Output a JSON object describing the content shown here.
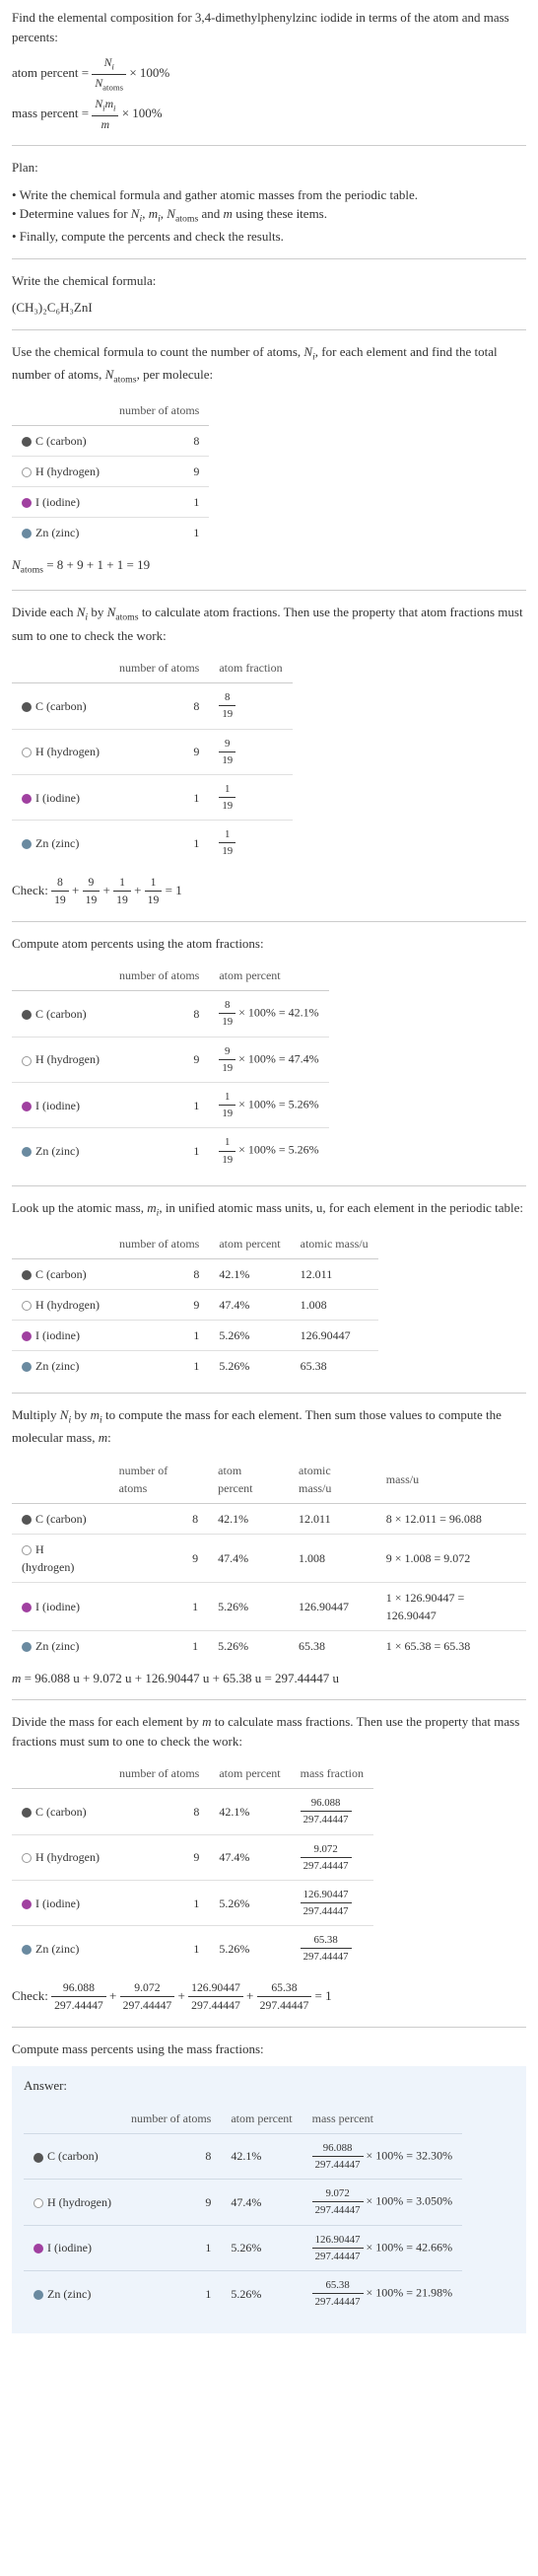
{
  "title": "Find the elemental composition for 3,4-dimethylphenylzinc iodide in terms of the atom and mass percents:",
  "atom_percent_formula": "atom percent = ",
  "atom_percent_frac_num": "N_i",
  "atom_percent_frac_den": "N_atoms",
  "times_100": " × 100%",
  "mass_percent_formula": "mass percent = ",
  "mass_percent_frac_num": "N_i m_i",
  "mass_percent_frac_den": "m",
  "plan_title": "Plan:",
  "plan_1": "• Write the chemical formula and gather atomic masses from the periodic table.",
  "plan_2": "• Determine values for N_i, m_i, N_atoms and m using these items.",
  "plan_3": "• Finally, compute the percents and check the results.",
  "write_formula_title": "Write the chemical formula:",
  "chem_formula": "(CH₃)₂C₆H₃ZnI",
  "count_atoms_text": "Use the chemical formula to count the number of atoms, N_i, for each element and find the total number of atoms, N_atoms, per molecule:",
  "headers": {
    "element": "",
    "num_atoms": "number of atoms",
    "atom_fraction": "atom fraction",
    "atom_percent": "atom percent",
    "atomic_mass": "atomic mass/u",
    "mass": "mass/u",
    "mass_fraction": "mass fraction",
    "mass_percent": "mass percent"
  },
  "elements": [
    {
      "symbol": "C",
      "name": "(carbon)",
      "dot": "dot-c",
      "n": "8",
      "frac_num": "8",
      "frac_den": "19",
      "pct": "42.1%",
      "pct_calc_num": "8",
      "mass": "12.011",
      "mass_calc": "8 × 12.011 = 96.088",
      "mass_val": "96.088",
      "mass_frac_num": "96.088",
      "final_pct": "32.30%",
      "final_mass_pct_calc_num": "96.088"
    },
    {
      "symbol": "H",
      "name": "(hydrogen)",
      "dot": "dot-h",
      "n": "9",
      "frac_num": "9",
      "frac_den": "19",
      "pct": "47.4%",
      "pct_calc_num": "9",
      "mass": "1.008",
      "mass_calc": "9 × 1.008 = 9.072",
      "mass_val": "9.072",
      "mass_frac_num": "9.072",
      "final_pct": "3.050%",
      "final_mass_pct_calc_num": "9.072"
    },
    {
      "symbol": "I",
      "name": "(iodine)",
      "dot": "dot-i",
      "n": "1",
      "frac_num": "1",
      "frac_den": "19",
      "pct": "5.26%",
      "pct_calc_num": "1",
      "mass": "126.90447",
      "mass_calc": "1 × 126.90447 = 126.90447",
      "mass_val": "126.90447",
      "mass_frac_num": "126.90447",
      "final_pct": "42.66%",
      "final_mass_pct_calc_num": "126.90447"
    },
    {
      "symbol": "Zn",
      "name": "(zinc)",
      "dot": "dot-zn",
      "n": "1",
      "frac_num": "1",
      "frac_den": "19",
      "pct": "5.26%",
      "pct_calc_num": "1",
      "mass": "65.38",
      "mass_calc": "1 × 65.38 = 65.38",
      "mass_val": "65.38",
      "mass_frac_num": "65.38",
      "final_pct": "21.98%",
      "final_mass_pct_calc_num": "65.38"
    }
  ],
  "n_atoms_calc": "N_atoms = 8 + 9 + 1 + 1 = 19",
  "divide_text": "Divide each N_i by N_atoms to calculate atom fractions. Then use the property that atom fractions must sum to one to check the work:",
  "check_frac_text": "Check: ",
  "check_frac_eq_1": " = 1",
  "compute_atom_pct": "Compute atom percents using the atom fractions:",
  "lookup_mass": "Look up the atomic mass, m_i, in unified atomic mass units, u, for each element in the periodic table:",
  "multiply_text": "Multiply N_i by m_i to compute the mass for each element. Then sum those values to compute the molecular mass, m:",
  "m_calc": "m = 96.088 u + 9.072 u + 126.90447 u + 65.38 u = 297.44447 u",
  "divide_mass_text": "Divide the mass for each element by m to calculate mass fractions. Then use the property that mass fractions must sum to one to check the work:",
  "mass_den": "297.44447",
  "compute_mass_pct": "Compute mass percents using the mass fractions:",
  "answer_label": "Answer:",
  "chart_data": {
    "type": "table",
    "title": "Elemental composition of 3,4-dimethylphenylzinc iodide",
    "elements": [
      "C",
      "H",
      "I",
      "Zn"
    ],
    "number_of_atoms": [
      8,
      9,
      1,
      1
    ],
    "N_atoms": 19,
    "atom_percent": [
      42.1,
      47.4,
      5.26,
      5.26
    ],
    "atomic_mass_u": [
      12.011,
      1.008,
      126.90447,
      65.38
    ],
    "element_mass_u": [
      96.088,
      9.072,
      126.90447,
      65.38
    ],
    "molecular_mass_u": 297.44447,
    "mass_percent": [
      32.3,
      3.05,
      42.66,
      21.98
    ]
  }
}
